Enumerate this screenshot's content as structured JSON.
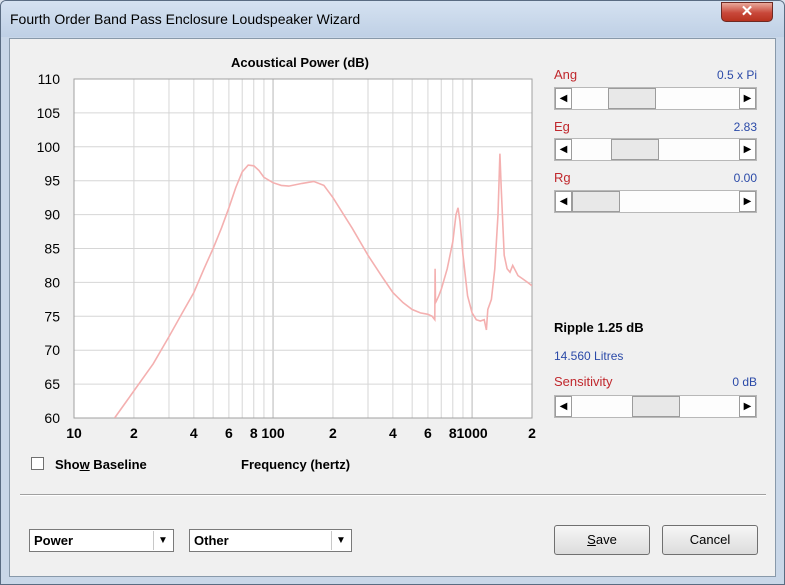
{
  "window": {
    "title": "Fourth Order Band Pass Enclosure Loudspeaker Wizard",
    "close_glyph": "✕"
  },
  "chart_data": {
    "type": "line",
    "title": "Acoustical Power (dB)",
    "xlabel": "Frequency (hertz)",
    "ylabel": "",
    "x_scale": "log",
    "xlim": [
      10,
      2000
    ],
    "ylim": [
      60,
      110
    ],
    "y_ticks": [
      60,
      65,
      70,
      75,
      80,
      85,
      90,
      95,
      100,
      105,
      110
    ],
    "x_tick_labels": [
      {
        "value": 10,
        "label": "10"
      },
      {
        "value": 20,
        "label": "2"
      },
      {
        "value": 40,
        "label": "4"
      },
      {
        "value": 60,
        "label": "6"
      },
      {
        "value": 80,
        "label": "8"
      },
      {
        "value": 100,
        "label": "100"
      },
      {
        "value": 200,
        "label": "2"
      },
      {
        "value": 400,
        "label": "4"
      },
      {
        "value": 600,
        "label": "6"
      },
      {
        "value": 800,
        "label": "8"
      },
      {
        "value": 1000,
        "label": "1000"
      },
      {
        "value": 2000,
        "label": "2"
      }
    ],
    "grid": true,
    "series_color": "#f4b0b0",
    "series": [
      {
        "x": [
          16,
          20,
          25,
          30,
          35,
          40,
          45,
          50,
          55,
          60,
          65,
          70,
          75,
          80,
          85,
          90,
          100,
          110,
          120,
          140,
          160,
          180,
          200,
          250,
          300,
          350,
          400,
          450,
          500,
          550,
          600,
          630,
          650,
          652,
          655,
          660,
          680,
          700,
          750,
          800,
          830,
          850,
          870,
          900,
          950,
          1000,
          1050,
          1100,
          1150,
          1180,
          1200,
          1250,
          1300,
          1350,
          1380,
          1400,
          1450,
          1500,
          1550,
          1600,
          1700,
          1800,
          1900,
          2000
        ],
        "y": [
          60,
          64,
          68,
          72,
          75.5,
          78.5,
          82,
          85,
          88,
          91,
          94,
          96.3,
          97.3,
          97.2,
          96.5,
          95.5,
          94.7,
          94.3,
          94.2,
          94.6,
          94.9,
          94.3,
          92.5,
          88,
          84,
          81,
          78.5,
          77,
          76,
          75.5,
          75.3,
          75,
          74.5,
          82,
          77,
          77.2,
          78,
          79,
          82,
          86,
          90,
          91,
          89,
          84,
          78,
          75.5,
          74.5,
          74.3,
          74.5,
          73,
          76,
          77.5,
          82,
          90,
          99,
          94,
          84,
          82,
          81.5,
          82.5,
          81,
          80.5,
          80,
          79.5
        ]
      }
    ]
  },
  "controls": {
    "show_baseline_pre": "Sho",
    "show_baseline_key": "w",
    "show_baseline_post": " Baseline",
    "checkbox_checked": false,
    "ang": {
      "label": "Ang",
      "value": "0.5 x Pi",
      "position_fraction": 0.3
    },
    "eg": {
      "label": "Eg",
      "value": "2.83",
      "position_fraction": 0.33
    },
    "rg": {
      "label": "Rg",
      "value": "0.00",
      "position_fraction": 0.0
    },
    "ripple": "Ripple 1.25 dB",
    "litres": "14.560 Litres",
    "sensitivity": {
      "label": "Sensitivity",
      "value": "0 dB",
      "position_fraction": 0.5
    }
  },
  "footer": {
    "select1": "Power",
    "select2": "Other",
    "save_key": "S",
    "save_rest": "ave",
    "cancel": "Cancel",
    "arrow_glyph": "▼"
  }
}
